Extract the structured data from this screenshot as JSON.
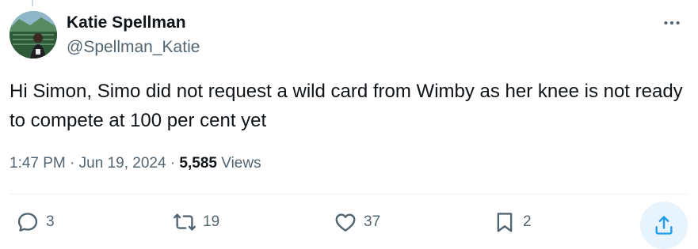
{
  "author": {
    "name": "Katie Spellman",
    "handle": "@Spellman_Katie"
  },
  "tweet": {
    "text": "Hi Simon, Simo did not request a wild card from Wimby as her knee is not ready to compete at 100 per cent yet",
    "time": "1:47 PM",
    "separator": "·",
    "date": "Jun 19, 2024",
    "views_count": "5,585",
    "views_label": "Views"
  },
  "actions": {
    "replies": "3",
    "reposts": "19",
    "likes": "37",
    "bookmarks": "2"
  },
  "icons": {
    "more": "more-options-icon",
    "reply": "reply-icon",
    "repost": "repost-icon",
    "like": "heart-icon",
    "bookmark": "bookmark-icon",
    "share": "share-icon"
  },
  "colors": {
    "text": "#0f1419",
    "secondary": "#536471",
    "accent": "#1d9bf0",
    "share_bg": "#e8f4fd"
  }
}
